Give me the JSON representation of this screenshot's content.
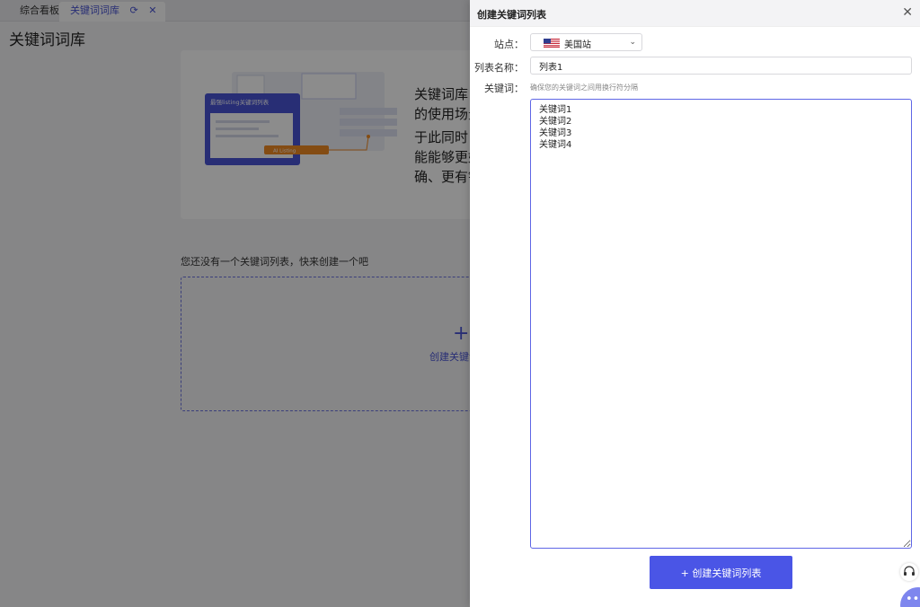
{
  "tabs": [
    {
      "label": "综合看板",
      "active": false
    },
    {
      "label": "关键词词库",
      "active": true
    }
  ],
  "page": {
    "title": "关键词词库",
    "intro_lines": [
      "关键词库",
      "的使用场景",
      "于此同时，",
      "能能够更好",
      "确、更有针"
    ],
    "illustration_card_title": "最强listing关键词列表",
    "illustration_badge": "AI Listing",
    "empty_tip": "您还没有一个关键词列表，快来创建一个吧",
    "create_label": "创建关键词",
    "create_plus": "+"
  },
  "drawer": {
    "title": "创建关键词列表",
    "site_label": "站点：",
    "site_value": "美国站",
    "name_label": "列表名称：",
    "name_value": "列表1",
    "keywords_label": "关键词：",
    "keywords_hint": "确保您的关键词之间用换行符分隔",
    "keywords_value": "关键词1\n关键词2\n关键词3\n关键词4",
    "submit_label": "+ 创建关键词列表"
  },
  "colors": {
    "accent": "#4a55e6",
    "overlay": "#000000"
  },
  "icons": {
    "refresh": "refresh-icon",
    "close_tab": "close-icon",
    "close_drawer": "close-icon",
    "caret": "chevron-down-icon",
    "flag": "us-flag-icon",
    "headset": "headset-icon",
    "more": "more-icon"
  }
}
